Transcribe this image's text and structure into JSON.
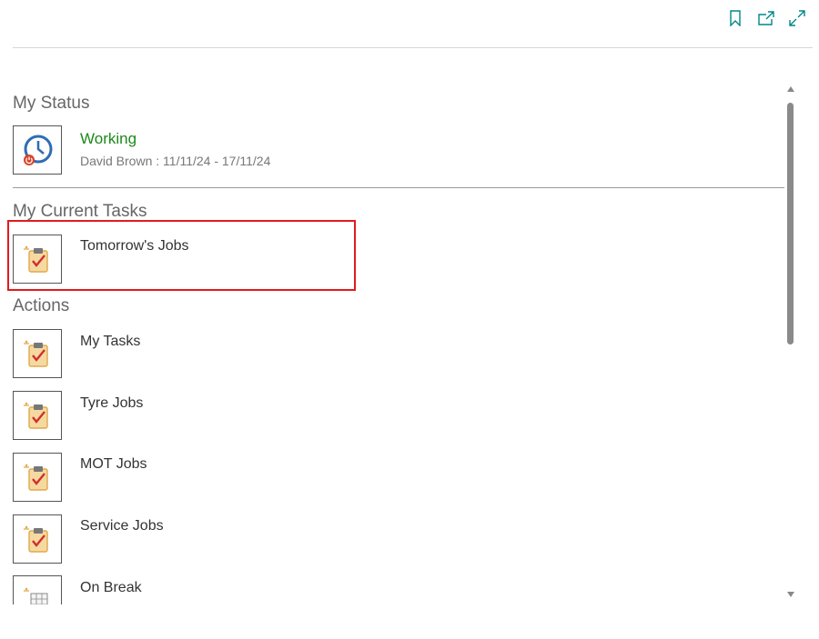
{
  "toolbar": {
    "icons": [
      "bookmark-icon",
      "share-icon",
      "expand-icon"
    ],
    "accent_color": "#00878a"
  },
  "status_section": {
    "title": "My Status",
    "status": "Working",
    "status_color": "#1a8a1a",
    "detail": "David Brown : 11/11/24 - 17/11/24"
  },
  "tasks_section": {
    "title": "My Current Tasks",
    "items": [
      {
        "label": "Tomorrow's Jobs"
      }
    ]
  },
  "actions_section": {
    "title": "Actions",
    "items": [
      {
        "label": "My Tasks"
      },
      {
        "label": "Tyre Jobs"
      },
      {
        "label": "MOT Jobs"
      },
      {
        "label": "Service Jobs"
      },
      {
        "label": "On Break"
      }
    ]
  },
  "highlight_color": "#e21b1b"
}
